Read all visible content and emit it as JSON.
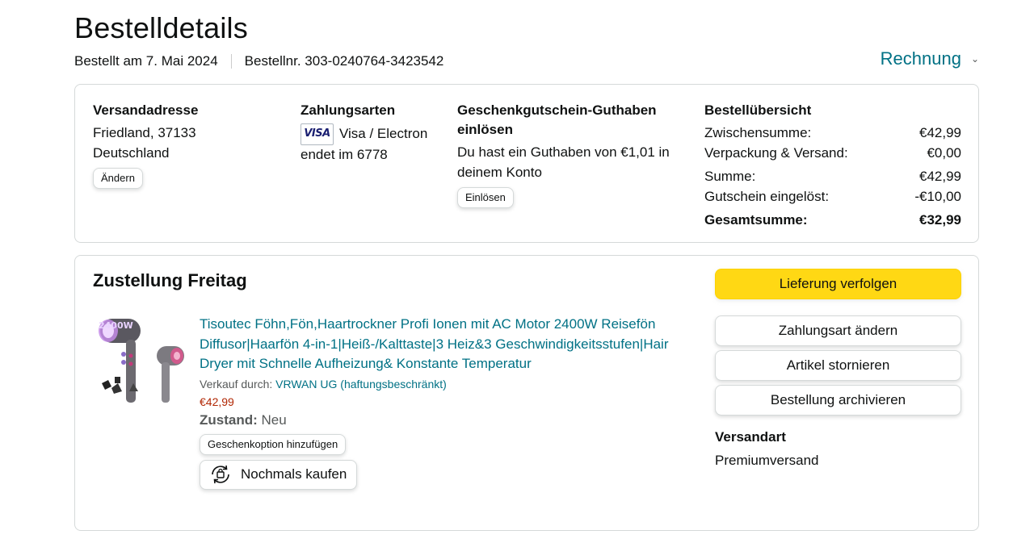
{
  "header": {
    "title": "Bestelldetails",
    "order_date": "Bestellt am 7. Mai 2024",
    "order_number": "Bestellnr. 303-0240764-3423542",
    "invoice_label": "Rechnung"
  },
  "summary": {
    "address": {
      "heading": "Versandadresse",
      "line1": "Friedland, 37133",
      "line2": "Deutschland",
      "change_label": "Ändern"
    },
    "payment": {
      "heading": "Zahlungsarten",
      "card_brand_logo": "VISA",
      "card_name": "Visa / Electron",
      "card_ending": "endet im 6778"
    },
    "gift_card": {
      "heading_line1": "Geschenkgutschein-Guthaben",
      "heading_line2": "einlösen",
      "balance_line1": "Du hast ein Guthaben von €1,01 in",
      "balance_line2": "deinem Konto",
      "redeem_label": "Einlösen"
    },
    "totals": {
      "heading": "Bestellübersicht",
      "rows": [
        {
          "label": "Zwischensumme:",
          "value": "€42,99"
        },
        {
          "label": "Verpackung & Versand:",
          "value": "€0,00"
        },
        {
          "label": "Summe:",
          "value": "€42,99"
        },
        {
          "label": "Gutschein eingelöst:",
          "value": "-€10,00"
        },
        {
          "label": "Gesamtsumme:",
          "value": "€32,99"
        }
      ]
    }
  },
  "shipment": {
    "title": "Zustellung Freitag",
    "product": {
      "image_label": "2400W",
      "title": "Tisoutec Föhn,Fön,Haartrockner Profi Ionen mit AC Motor 2400W Reisefön Diffusor|Haarfön 4-in-1|Heiß-/Kalttaste|3 Heiz&3 Geschwindigkeitsstufen|Hair Dryer mit Schnelle Aufheizung& Konstante Temperatur",
      "seller_prefix": "Verkauf durch:",
      "seller_name": "VRWAN UG (haftungsbeschränkt)",
      "price": "€42,99",
      "condition_label": "Zustand:",
      "condition_value": "Neu",
      "gift_option_label": "Geschenkoption hinzufügen",
      "buy_again_label": "Nochmals kaufen"
    },
    "actions": {
      "track": "Lieferung verfolgen",
      "change_payment": "Zahlungsart ändern",
      "cancel": "Artikel stornieren",
      "archive": "Bestellung archivieren"
    },
    "shipping_method": {
      "heading": "Versandart",
      "value": "Premiumversand"
    }
  },
  "colors": {
    "link": "#007185",
    "price": "#b12704",
    "primary_button": "#ffd814",
    "border": "#d5d9d9"
  }
}
